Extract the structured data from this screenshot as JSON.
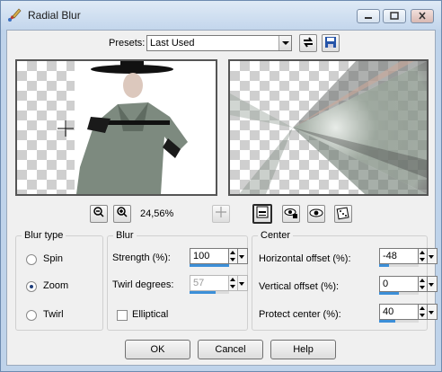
{
  "window": {
    "title": "Radial Blur"
  },
  "presets": {
    "label": "Presets:",
    "value": "Last Used"
  },
  "zoom": {
    "value": "24,56%"
  },
  "blur_type": {
    "legend": "Blur type",
    "options": [
      {
        "label": "Spin",
        "selected": false
      },
      {
        "label": "Zoom",
        "selected": true
      },
      {
        "label": "Twirl",
        "selected": false
      }
    ]
  },
  "blur": {
    "legend": "Blur",
    "strength_label": "Strength (%):",
    "strength_value": "100",
    "strength_fraction": 1.0,
    "twirl_label": "Twirl degrees:",
    "twirl_value": "57",
    "twirl_fraction": 0.65,
    "elliptical_label": "Elliptical",
    "elliptical_checked": false
  },
  "center": {
    "legend": "Center",
    "h_offset_label": "Horizontal offset (%):",
    "h_offset_value": "-48",
    "h_offset_fraction": 0.26,
    "v_offset_label": "Vertical offset (%):",
    "v_offset_value": "0",
    "v_offset_fraction": 0.5,
    "protect_label": "Protect center (%):",
    "protect_value": "40",
    "protect_fraction": 0.4
  },
  "buttons": {
    "ok": "OK",
    "cancel": "Cancel",
    "help": "Help"
  },
  "colors": {
    "accent": "#3c8fd8",
    "frame": "#bfd3ea",
    "jacket": "#7d8a7f"
  }
}
